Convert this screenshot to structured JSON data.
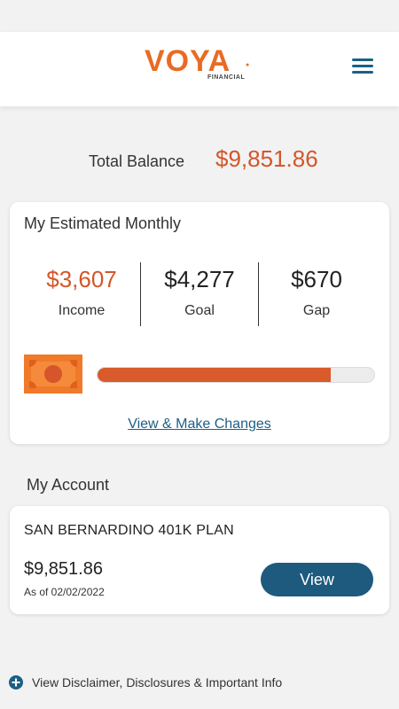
{
  "colors": {
    "accent_orange": "#d4562a",
    "brand_blue": "#1d5f86",
    "background": "#f2f2f2"
  },
  "header": {
    "logo_text": "VOYA",
    "logo_subtext": "FINANCIAL",
    "menu_icon": "hamburger-menu-icon"
  },
  "total_balance": {
    "label": "Total Balance",
    "value": "$9,851.86"
  },
  "estimated_monthly": {
    "title": "My Estimated Monthly",
    "metrics": [
      {
        "value": "$3,607",
        "label": "Income"
      },
      {
        "value": "$4,277",
        "label": "Goal"
      },
      {
        "value": "$670",
        "label": "Gap"
      }
    ],
    "icon": "money-bill-icon",
    "progress_fraction": 0.843,
    "link_label": "View & Make Changes"
  },
  "my_account": {
    "title": "My Account",
    "plan_name": "SAN BERNARDINO 401K PLAN",
    "balance": "$9,851.86",
    "as_of": "As of 02/02/2022",
    "view_button": "View"
  },
  "footer": {
    "icon": "plus-circle-icon",
    "disclaimer_label": "View Disclaimer, Disclosures & Important Info"
  }
}
